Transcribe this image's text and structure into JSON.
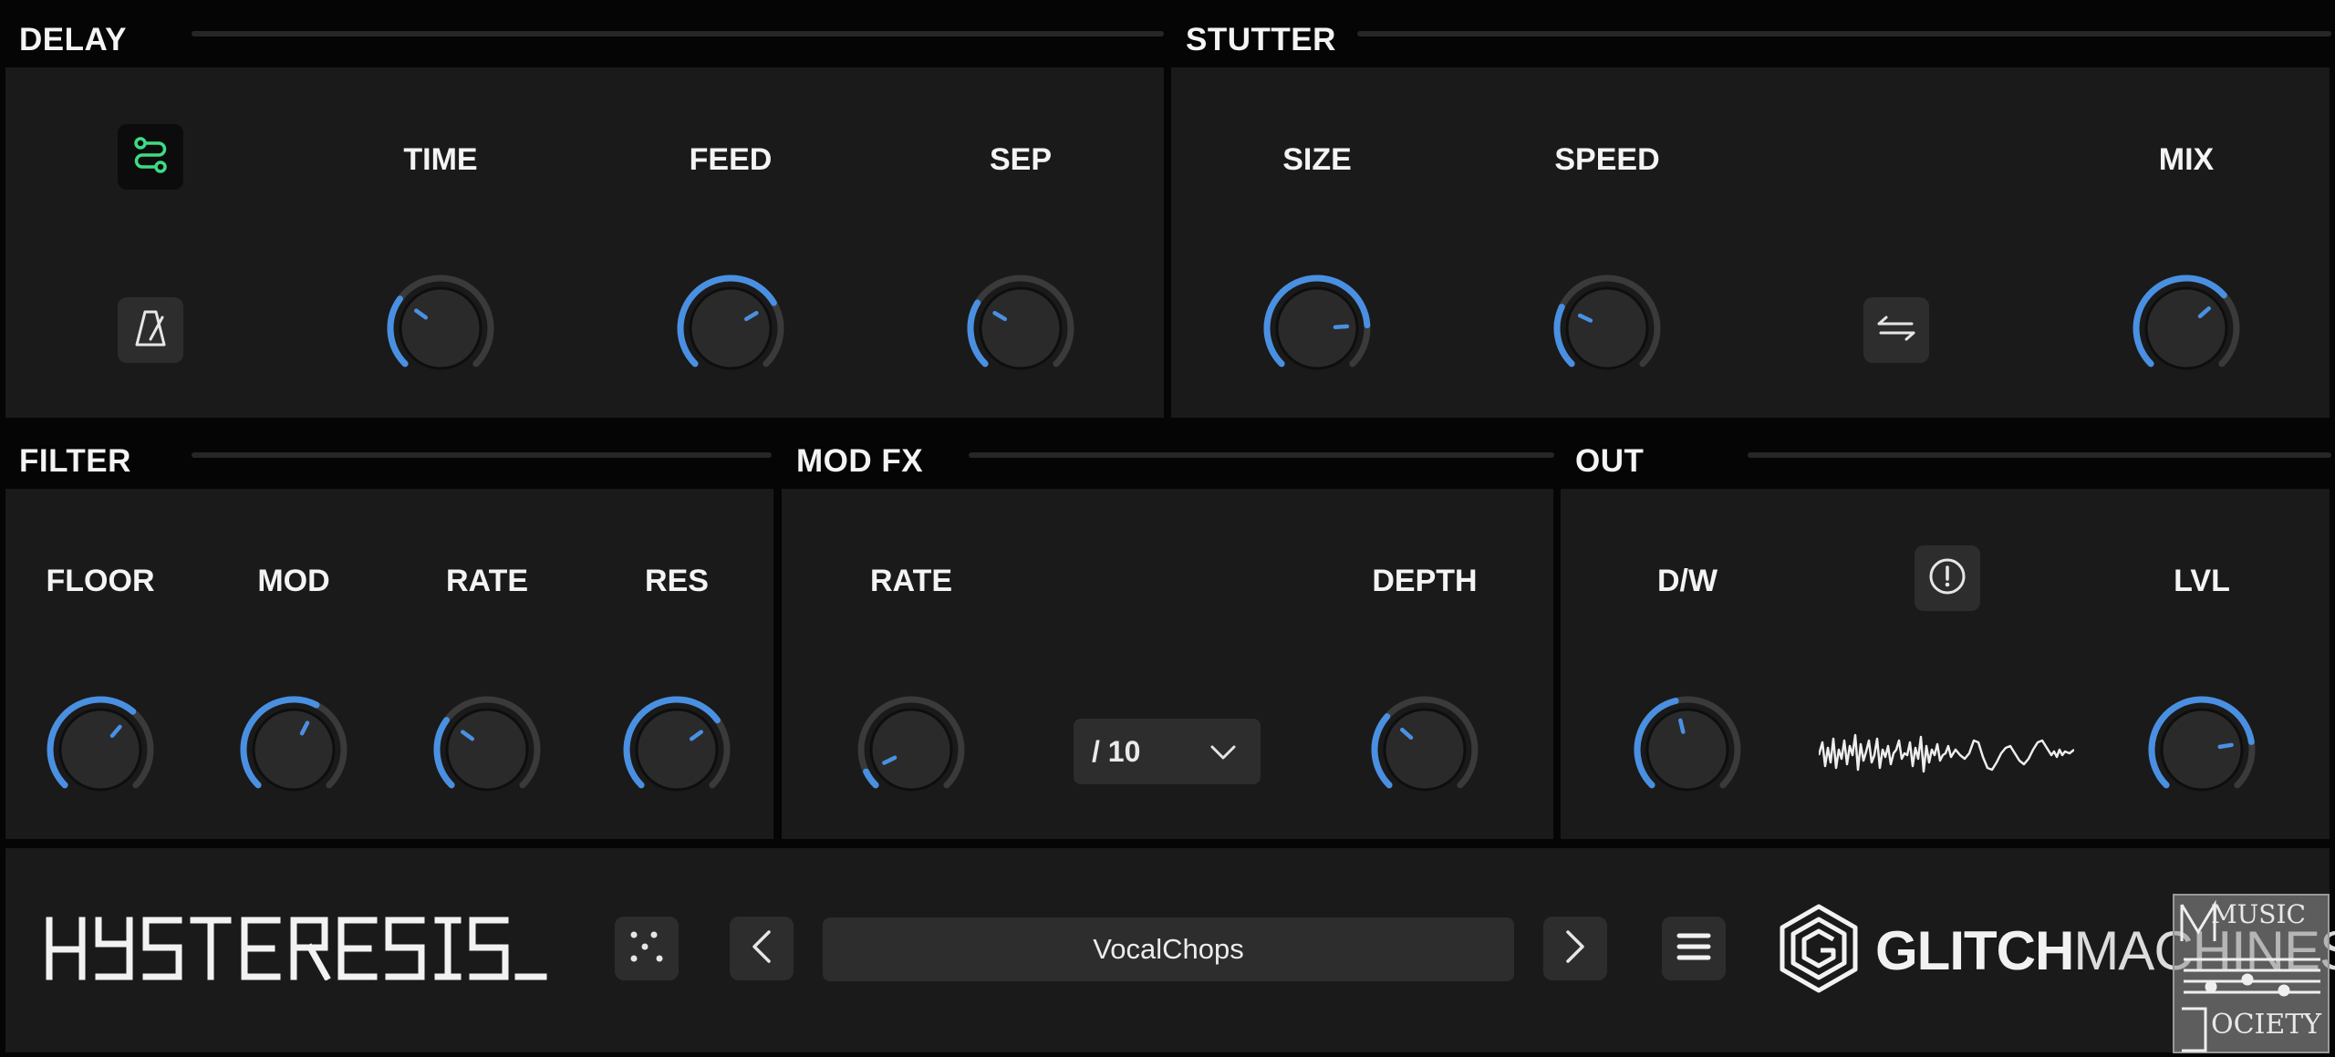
{
  "sections": {
    "delay": "DELAY",
    "stutter": "STUTTER",
    "filter": "FILTER",
    "modfx": "MOD FX",
    "out": "OUT"
  },
  "delay": {
    "time_label": "TIME",
    "feed_label": "FEED",
    "sep_label": "SEP",
    "sync_icon": "sync-path-icon",
    "metronome_icon": "metronome-icon",
    "knob_levels": {
      "time": 0.3,
      "feed": 0.72,
      "sep": 0.28
    }
  },
  "stutter": {
    "size_label": "SIZE",
    "speed_label": "SPEED",
    "mix_label": "MIX",
    "swap_icon": "swap-arrows-icon",
    "knob_levels": {
      "size": 0.82,
      "speed": 0.26,
      "mix": 0.68
    }
  },
  "filter": {
    "floor_label": "FLOOR",
    "mod_label": "MOD",
    "rate_label": "RATE",
    "res_label": "RES",
    "knob_levels": {
      "floor": 0.65,
      "mod": 0.6,
      "rate": 0.3,
      "res": 0.7
    }
  },
  "modfx": {
    "rate_label": "RATE",
    "depth_label": "DEPTH",
    "division_value": "/ 10",
    "knob_levels": {
      "rate": 0.07,
      "depth": 0.32
    }
  },
  "out": {
    "dw_label": "D/W",
    "lvl_label": "LVL",
    "info_icon": "alert-icon",
    "knob_levels": {
      "dw": 0.45,
      "lvl": 0.8
    }
  },
  "footer": {
    "brand": "HYSTERESIS_",
    "preset_name": "VocalChops",
    "company_bold": "GLITCH",
    "company_light": "MACHINES",
    "watermark_1": "MUSIC",
    "watermark_2": "OCIETY"
  },
  "colors": {
    "accent": "#4a90e2",
    "panel": "#1a1a1a",
    "background": "#050505",
    "green": "#3ddc84"
  }
}
